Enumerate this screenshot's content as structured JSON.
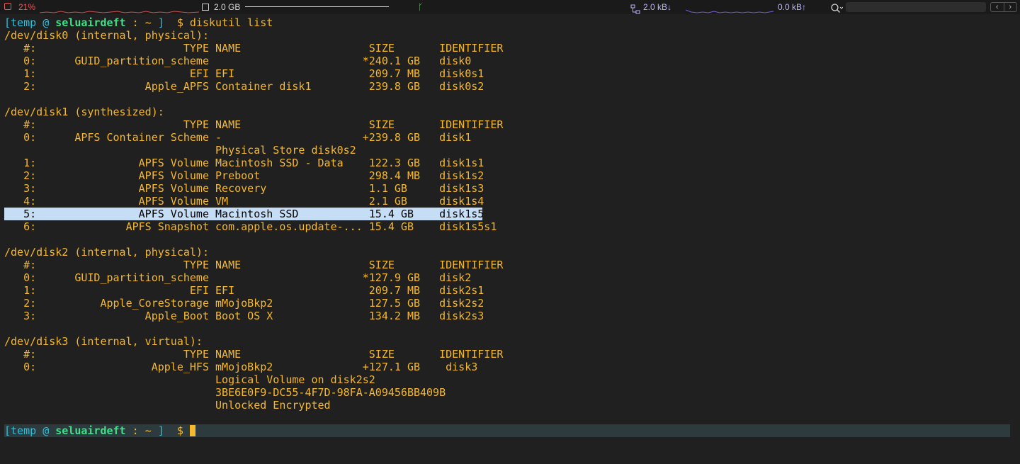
{
  "statusbar": {
    "cpu": "21%",
    "memory": "2.0 GB",
    "net_down": "2.0 kB↓",
    "net_up": "0.0 kB↑",
    "branch_glyph": "ᚴ",
    "nav_prev": "‹",
    "nav_next": "›"
  },
  "prompt": {
    "open": "[",
    "user": "temp",
    "at": "@",
    "host": "seluairdeft",
    "sep": ":",
    "path": "~",
    "close": "]",
    "symbol": "$"
  },
  "command": "diskutil list",
  "output_lines": [
    "/dev/disk0 (internal, physical):",
    "   #:                       TYPE NAME                    SIZE       IDENTIFIER",
    "   0:      GUID_partition_scheme                        *240.1 GB   disk0",
    "   1:                        EFI EFI                     209.7 MB   disk0s1",
    "   2:                 Apple_APFS Container disk1         239.8 GB   disk0s2",
    "",
    "/dev/disk1 (synthesized):",
    "   #:                       TYPE NAME                    SIZE       IDENTIFIER",
    "   0:      APFS Container Scheme -                      +239.8 GB   disk1",
    "                                 Physical Store disk0s2",
    "   1:                APFS Volume Macintosh SSD - Data    122.3 GB   disk1s1",
    "   2:                APFS Volume Preboot                 298.4 MB   disk1s2",
    "   3:                APFS Volume Recovery                1.1 GB     disk1s3",
    "   4:                APFS Volume VM                      2.1 GB     disk1s4",
    "   5:                APFS Volume Macintosh SSD           15.4 GB    disk1s5",
    "   6:              APFS Snapshot com.apple.os.update-... 15.4 GB    disk1s5s1",
    "",
    "/dev/disk2 (internal, physical):",
    "   #:                       TYPE NAME                    SIZE       IDENTIFIER",
    "   0:      GUID_partition_scheme                        *127.9 GB   disk2",
    "   1:                        EFI EFI                     209.7 MB   disk2s1",
    "   2:          Apple_CoreStorage mMojoBkp2               127.5 GB   disk2s2",
    "   3:                 Apple_Boot Boot OS X               134.2 MB   disk2s3",
    "",
    "/dev/disk3 (internal, virtual):",
    "   #:                       TYPE NAME                    SIZE       IDENTIFIER",
    "   0:                  Apple_HFS mMojoBkp2              +127.1 GB    disk3",
    "                                 Logical Volume on disk2s2",
    "                                 3BE6E0F9-DC55-4F7D-98FA-A09456BB409B",
    "                                 Unlocked Encrypted"
  ],
  "highlighted_line_index": 14
}
